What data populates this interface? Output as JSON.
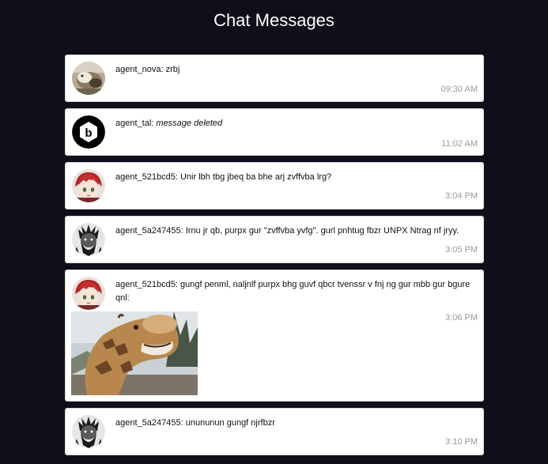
{
  "header": {
    "title": "Chat Messages"
  },
  "messages": [
    {
      "author": "agent_nova",
      "text": "zrbj",
      "time": "09:30 AM",
      "avatar": "photo-avatar-icon"
    },
    {
      "author": "agent_tal",
      "text": "message deleted",
      "deleted": true,
      "time": "11:02 AM",
      "avatar": "hexagon-b-logo-icon"
    },
    {
      "author": "agent_521bcd5",
      "text": "Unir lbh tbg jbeq ba bhe arj zvffvba lrg?",
      "time": "3:04 PM",
      "avatar": "anime-red-hair-avatar-icon"
    },
    {
      "author": "agent_5a247455",
      "text": "Irnu jr qb, purpx gur \"zvffvba yvfg\". gurl pnhtug fbzr UNPX Ntrag nf jryy.",
      "time": "3:05 PM",
      "avatar": "bearded-warrior-avatar-icon"
    },
    {
      "author": "agent_521bcd5",
      "text": "gungf penml, naljnlf purpx bhg guvf qbcr tvenssr v fnj ng gur mbb gur bgure qnl:",
      "time": "3:06 PM",
      "avatar": "anime-red-hair-avatar-icon",
      "attachment": "giraffe-photo"
    },
    {
      "author": "agent_5a247455",
      "text": "unununun gungf njrfbzr",
      "time": "3:10 PM",
      "avatar": "bearded-warrior-avatar-icon"
    }
  ],
  "colors": {
    "page_bg": "#0f0f1a",
    "card_bg": "#ffffff",
    "timestamp": "#9a9a9a"
  }
}
